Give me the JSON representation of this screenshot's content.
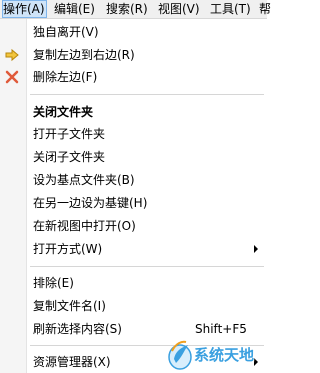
{
  "menubar": {
    "items": [
      {
        "label": "操作(A)",
        "active": true
      },
      {
        "label": "编辑(E)"
      },
      {
        "label": "搜索(R)"
      },
      {
        "label": "视图(V)"
      },
      {
        "label": "工具(T)"
      },
      {
        "label": "帮"
      }
    ]
  },
  "menu": {
    "items": [
      {
        "label": "独自离开(V)"
      },
      {
        "label": "复制左边到右边(R)",
        "icon": "arrow-right-icon"
      },
      {
        "label": "删除左边(F)",
        "icon": "delete-x-icon"
      },
      {
        "label": "关闭文件夹",
        "bold": true
      },
      {
        "label": "打开子文件夹"
      },
      {
        "label": "关闭子文件夹"
      },
      {
        "label": "设为基点文件夹(B)"
      },
      {
        "label": "在另一边设为基键(H)"
      },
      {
        "label": "在新视图中打开(O)"
      },
      {
        "label": "打开方式(W)",
        "submenu": true
      },
      {
        "label": "排除(E)"
      },
      {
        "label": "复制文件名(I)"
      },
      {
        "label": "刷新选择内容(S)",
        "shortcut": "Shift+F5"
      },
      {
        "label": "资源管理器(X)",
        "submenu": true
      }
    ]
  },
  "watermark": {
    "text": "系统天地"
  },
  "colors": {
    "menubar_bg": "#f0f0f0",
    "active_bg": "#cfe4f8",
    "arrow_icon": "#f2c53d",
    "delete_icon": "#e05a3a",
    "watermark": "#3aa0e0"
  }
}
